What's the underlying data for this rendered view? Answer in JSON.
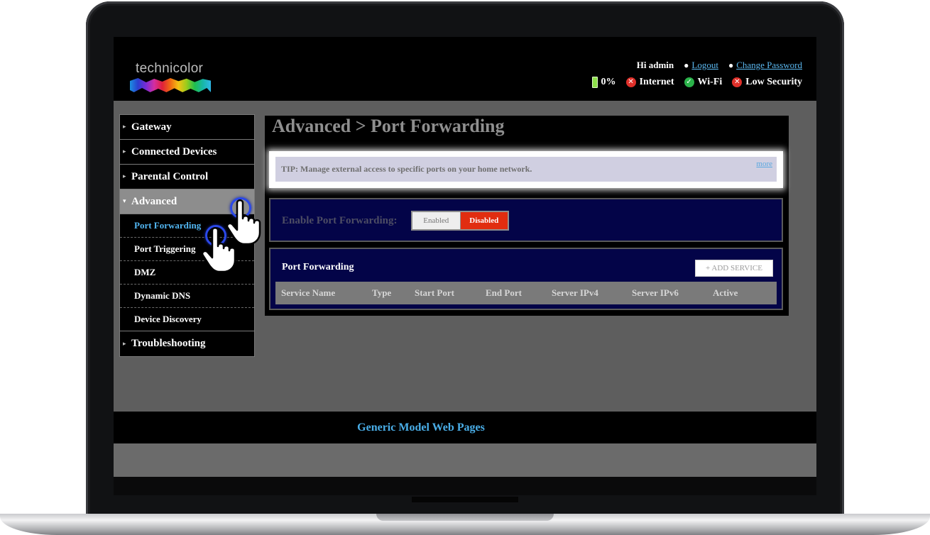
{
  "brand": {
    "name": "technicolor"
  },
  "header": {
    "greeting": "Hi admin",
    "logout": "Logout",
    "change_password": "Change Password",
    "battery": "0%",
    "internet": "Internet",
    "wifi": "Wi-Fi",
    "security": "Low Security",
    "colors": {
      "error": "#e0302a",
      "ok": "#2bb34a",
      "battery": "#8de04a"
    }
  },
  "nav": {
    "items": [
      {
        "label": "Gateway"
      },
      {
        "label": "Connected Devices"
      },
      {
        "label": "Parental Control"
      },
      {
        "label": "Advanced"
      },
      {
        "label": "Troubleshooting"
      }
    ],
    "sub_items": [
      {
        "label": "Port Forwarding"
      },
      {
        "label": "Port Triggering"
      },
      {
        "label": "DMZ"
      },
      {
        "label": "Dynamic DNS"
      },
      {
        "label": "Device Discovery"
      }
    ]
  },
  "main": {
    "title": "Advanced > Port Forwarding",
    "tip": "TIP: Manage external access to specific ports on your home network.",
    "more": "more",
    "enable_label": "Enable Port Forwarding:",
    "enabled": "Enabled",
    "disabled": "Disabled",
    "section_title": "Port Forwarding",
    "add_service": "+ ADD SERVICE",
    "columns": [
      "Service Name",
      "Type",
      "Start Port",
      "End Port",
      "Server IPv4",
      "Server IPv6",
      "Active"
    ]
  },
  "footer": {
    "text": "Generic Model Web Pages"
  }
}
